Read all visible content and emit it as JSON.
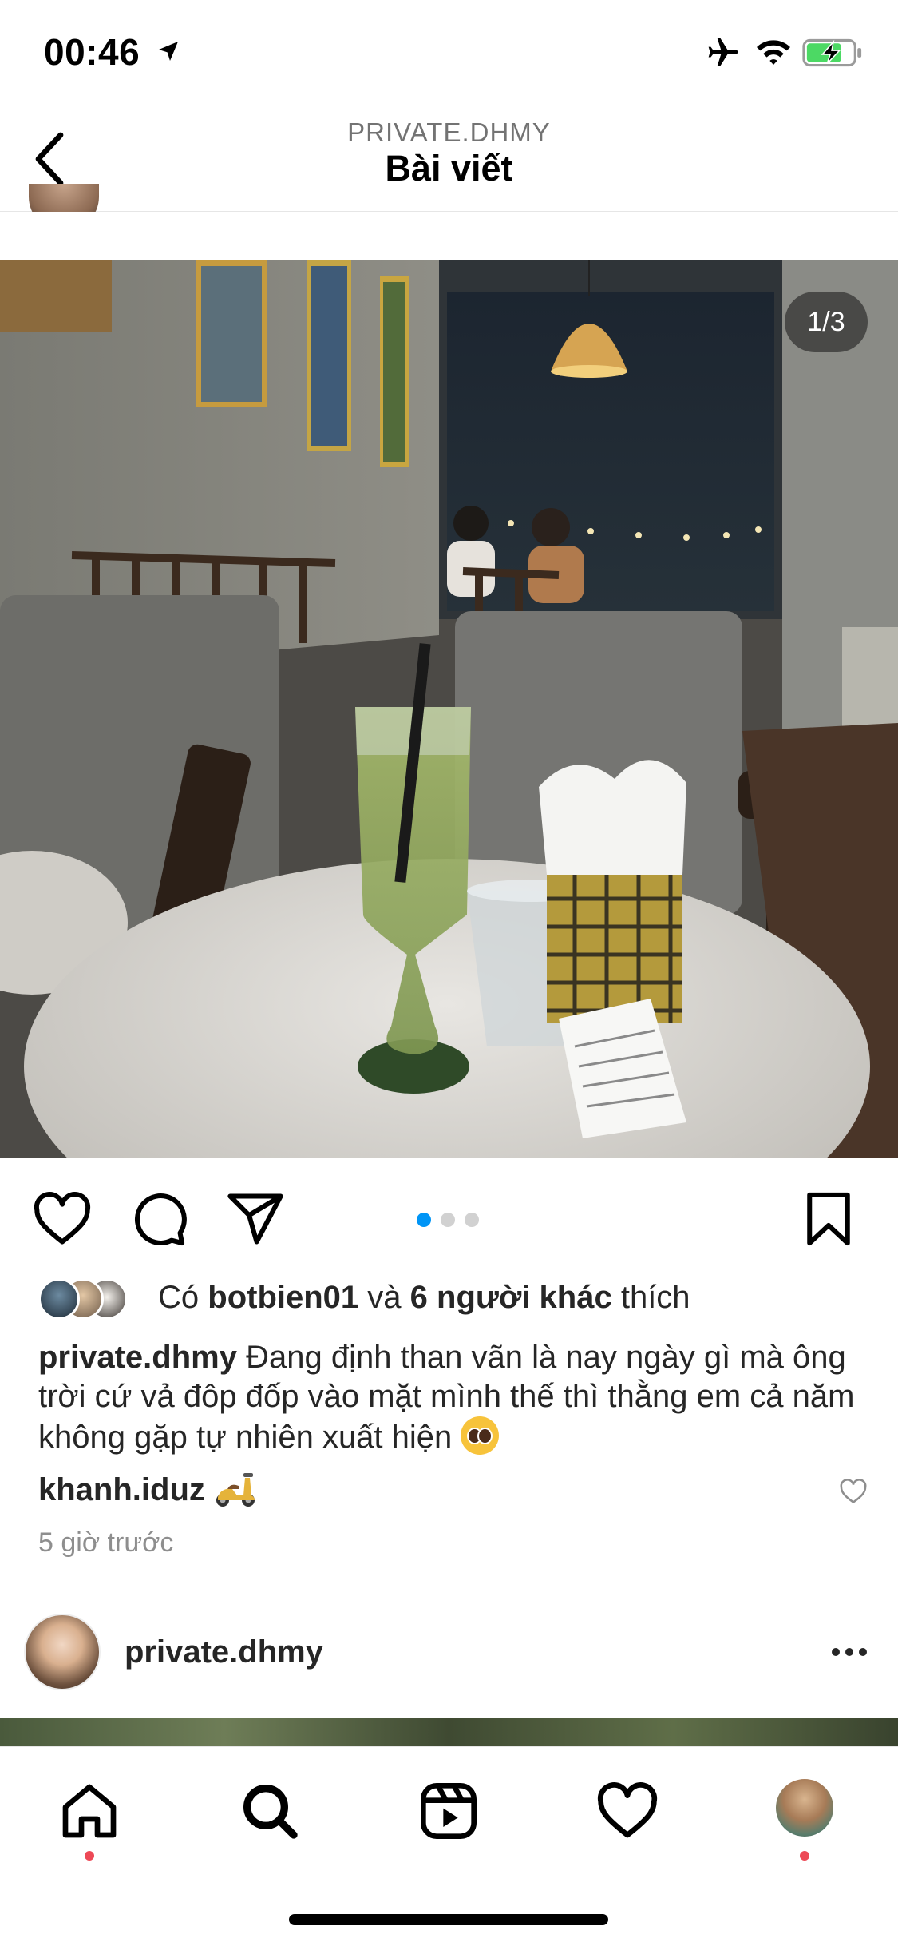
{
  "status_bar": {
    "time": "00:46",
    "icons": [
      "location-arrow-icon",
      "airplane-icon",
      "wifi-icon",
      "battery-charging-icon"
    ]
  },
  "header": {
    "subtitle": "PRIVATE.DHMY",
    "title": "Bài viết",
    "back_icon": "chevron-left-icon"
  },
  "post": {
    "photo_counter": "1/3",
    "carousel_dots": {
      "count": 3,
      "active_index": 0,
      "active_color": "#0095f6"
    },
    "likes": {
      "prefix": "Có",
      "first_liker": "botbien01",
      "connector": "và",
      "others": "6 người khác",
      "suffix": "thích"
    },
    "caption": {
      "username": "private.dhmy",
      "text": "Đang định than vãn là nay ngày gì mà ông trời cứ vả đôp đốp vào mặt mình thế thì thằng em cả năm không gặp tự nhiên xuất hiện",
      "emoji": "pleading-face-emoji"
    },
    "comment": {
      "username": "khanh.iduz",
      "emoji": "scooter-emoji"
    },
    "time_ago": "5 giờ trước"
  },
  "next_post": {
    "username": "private.dhmy"
  },
  "tab_bar": {
    "items": [
      "home-icon",
      "search-icon",
      "reels-icon",
      "heart-icon",
      "profile-avatar"
    ],
    "notification_color": "#ed4956"
  }
}
